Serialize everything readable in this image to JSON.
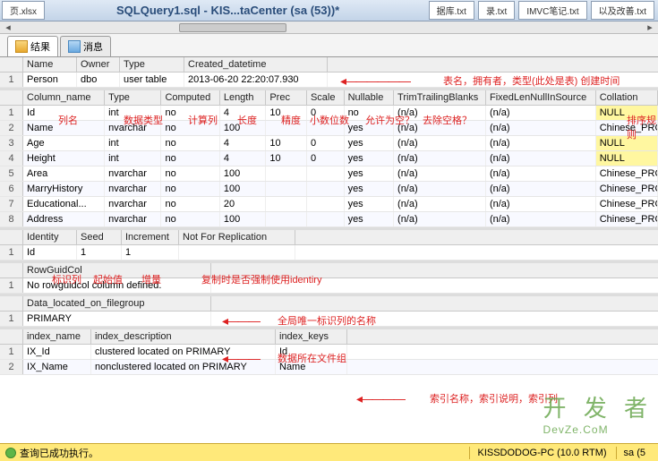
{
  "titlebar": {
    "tab_left": "页.xlsx",
    "docname": "SQLQuery1.sql - KIS...taCenter (sa (53))*",
    "tabs_right": [
      "据库.txt",
      "录.txt",
      "IMVC笔记.txt",
      "以及改善.txt"
    ]
  },
  "maintabs": {
    "results": "结果",
    "messages": "消息"
  },
  "section1": {
    "headers": [
      "Name",
      "Owner",
      "Type",
      "Created_datetime"
    ],
    "widths": [
      60,
      48,
      72,
      160
    ],
    "rows": [
      [
        "Person",
        "dbo",
        "user table",
        "2013-06-20 22:20:07.930"
      ]
    ]
  },
  "section2": {
    "headers": [
      "Column_name",
      "Type",
      "Computed",
      "Length",
      "Prec",
      "Scale",
      "Nullable",
      "TrimTrailingBlanks",
      "FixedLenNullInSource",
      "Collation"
    ],
    "widths": [
      92,
      64,
      66,
      52,
      46,
      42,
      56,
      104,
      124,
      70
    ],
    "rows": [
      [
        "Id",
        "int",
        "no",
        "4",
        "10",
        "0",
        "no",
        "(n/a)",
        "(n/a)",
        "NULL"
      ],
      [
        "Name",
        "nvarchar",
        "no",
        "100",
        "",
        "",
        "yes",
        "(n/a)",
        "(n/a)",
        "Chinese_PRC_C"
      ],
      [
        "Age",
        "int",
        "no",
        "4",
        "10",
        "0",
        "yes",
        "(n/a)",
        "(n/a)",
        "NULL"
      ],
      [
        "Height",
        "int",
        "no",
        "4",
        "10",
        "0",
        "yes",
        "(n/a)",
        "(n/a)",
        "NULL"
      ],
      [
        "Area",
        "nvarchar",
        "no",
        "100",
        "",
        "",
        "yes",
        "(n/a)",
        "(n/a)",
        "Chinese_PRC_C"
      ],
      [
        "MarryHistory",
        "nvarchar",
        "no",
        "100",
        "",
        "",
        "yes",
        "(n/a)",
        "(n/a)",
        "Chinese_PRC_C"
      ],
      [
        "Educational...",
        "nvarchar",
        "no",
        "20",
        "",
        "",
        "yes",
        "(n/a)",
        "(n/a)",
        "Chinese_PRC_C"
      ],
      [
        "Address",
        "nvarchar",
        "no",
        "100",
        "",
        "",
        "yes",
        "(n/a)",
        "(n/a)",
        "Chinese_PRC_C"
      ]
    ]
  },
  "section3": {
    "headers": [
      "Identity",
      "Seed",
      "Increment",
      "Not For Replication"
    ],
    "widths": [
      60,
      50,
      64,
      130
    ],
    "rows": [
      [
        "Id",
        "1",
        "1",
        ""
      ]
    ]
  },
  "section4": {
    "headers": [
      "RowGuidCol"
    ],
    "widths": [
      210
    ],
    "rows": [
      [
        "No rowguidcol column defined."
      ]
    ]
  },
  "section5": {
    "headers": [
      "Data_located_on_filegroup"
    ],
    "widths": [
      210
    ],
    "rows": [
      [
        "PRIMARY"
      ]
    ]
  },
  "section6": {
    "headers": [
      "index_name",
      "index_description",
      "index_keys"
    ],
    "widths": [
      76,
      206,
      80
    ],
    "rows": [
      [
        "IX_Id",
        "clustered located on PRIMARY",
        "Id"
      ],
      [
        "IX_Name",
        "nonclustered located on PRIMARY",
        "Name"
      ]
    ]
  },
  "annotations": {
    "a1": "表名，拥有者，类型(此处是表) 创建时间",
    "a2": "列名",
    "a3": "数据类型",
    "a4": "计算列",
    "a5": "长度",
    "a6": "精度",
    "a7": "小数位数",
    "a8": "允许为空？",
    "a9": "去除空格？",
    "a10": "排序规则",
    "a11": "标识列",
    "a12": "起始值",
    "a13": "增量",
    "a14": "复制时是否强制使用identiry",
    "a15": "全局唯一标识列的名称",
    "a16": "数据所在文件组",
    "a17": "索引名称，索引说明，索引列"
  },
  "statusbar": {
    "msg": "查询已成功执行。",
    "server": "KISSDODOG-PC (10.0 RTM)",
    "user": "sa (5"
  },
  "watermark": {
    "main": "开 发 者",
    "sub": "DevZe.CoM"
  }
}
